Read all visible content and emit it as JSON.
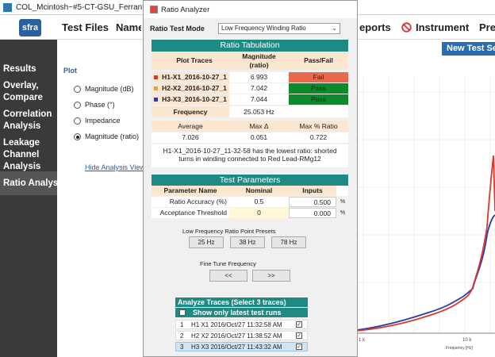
{
  "main_window": {
    "title": "COL_Mcintosh~#5-CT-GSU_Ferranti-Packard_TP",
    "logo_text": "sfra",
    "menu": [
      "Test Files",
      "Name",
      "eports",
      "Instrument",
      "Pre"
    ],
    "new_test_button": "New Test Sess"
  },
  "sidebar": {
    "items": [
      "Results",
      "Overlay, Compare",
      "Correlation Analysis",
      "Leakage Channel Analysis",
      "Ratio Analysis"
    ],
    "active": "Ratio Analysis"
  },
  "plot_panel": {
    "heading": "Plot",
    "options": [
      "Magnitude (dB)",
      "Phase (°)",
      "Impedance",
      "Magnitude (ratio)"
    ],
    "selected": "Magnitude (ratio)",
    "hide_link": "Hide Analysis View"
  },
  "graph": {
    "x_ticks": [
      "1 k",
      "10 k"
    ],
    "x_label": "Frequency [Hz]",
    "colors": {
      "trace1": "#d33c2c",
      "trace3": "#2a3aa8"
    }
  },
  "dialog": {
    "title": "Ratio Analyzer",
    "mode_label": "Ratio Test Mode",
    "mode_value": "Low Frequency Winding Ratio",
    "ratio_tabulation": {
      "title": "Ratio Tabulation",
      "headers": [
        "Plot Traces",
        "Magnitude\n(ratio)",
        "Pass/Fail"
      ],
      "rows": [
        {
          "trace": "H1-X1_2016-10-27_1",
          "value": "6.993",
          "status": "Fail",
          "color": "#d33c2c"
        },
        {
          "trace": "H2-X2_2016-10-27_1",
          "value": "7.042",
          "status": "Pass",
          "color": "#e5a23a"
        },
        {
          "trace": "H3-X3_2016-10-27_1",
          "value": "7.044",
          "status": "Pass",
          "color": "#2a3aa8"
        }
      ],
      "frequency_label": "Frequency",
      "frequency_value": "25.053 Hz",
      "stats_headers": [
        "Average",
        "Max Δ",
        "Max % Ratio"
      ],
      "stats_values": [
        "7.026",
        "0.051",
        "0.722"
      ],
      "note": "H1-X1_2016-10-27_11-32-58 has the lowest ratio: shorted turns in winding connected to Red Lead-RMg12"
    },
    "test_parameters": {
      "title": "Test Parameters",
      "headers": [
        "Parameter Name",
        "Nominal",
        "Inputs"
      ],
      "rows": [
        {
          "name": "Ratio Accuracy (%)",
          "nominal": "0.5",
          "input": "0.500",
          "unit": "%"
        },
        {
          "name": "Acceptance Threshold",
          "nominal": "0",
          "input": "0.000",
          "unit": "%"
        }
      ]
    },
    "presets": {
      "label": "Low Frequency Ratio Point Presets",
      "buttons": [
        "25 Hz",
        "38 Hz",
        "78 Hz"
      ]
    },
    "fine_tune": {
      "label": "Fine Tune Frequency",
      "back": "<<",
      "forward": ">>"
    },
    "analyze": {
      "title": "Analyze Traces (Select 3 traces)",
      "latest_label": "Show only latest test runs",
      "rows": [
        {
          "num": "1",
          "name": "H1 X1 2016/Oct/27 11:32:58 AM",
          "checked": "✓"
        },
        {
          "num": "2",
          "name": "H2 X2 2016/Oct/27 11:38:52 AM",
          "checked": "✓"
        },
        {
          "num": "3",
          "name": "H3 X3 2016/Oct/27 11:43:32 AM",
          "checked": "✓"
        }
      ]
    }
  }
}
